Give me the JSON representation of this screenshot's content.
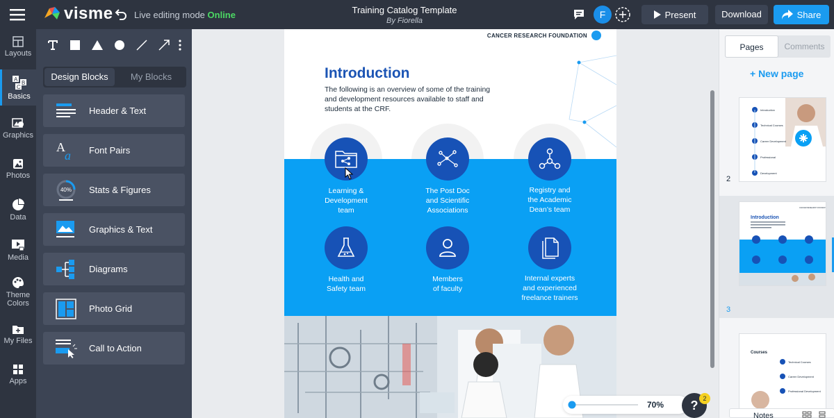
{
  "app": {
    "brand": "visme",
    "mode_label": "Live editing mode",
    "mode_status": "Online",
    "doc_title": "Training Catalog Template",
    "doc_author": "By Fiorella",
    "avatar_initial": "F",
    "present_label": "Present",
    "download_label": "Download",
    "share_label": "Share"
  },
  "leftnav": {
    "items": [
      {
        "label": "Layouts",
        "icon": "layouts-icon"
      },
      {
        "label": "Basics",
        "icon": "basics-icon"
      },
      {
        "label": "Graphics",
        "icon": "graphics-icon"
      },
      {
        "label": "Photos",
        "icon": "photos-icon"
      },
      {
        "label": "Data",
        "icon": "data-icon"
      },
      {
        "label": "Media",
        "icon": "media-icon"
      },
      {
        "label": "Theme Colors",
        "icon": "palette-icon"
      },
      {
        "label": "My Files",
        "icon": "folder-icon"
      },
      {
        "label": "Apps",
        "icon": "apps-icon"
      }
    ]
  },
  "panel": {
    "tabs": [
      "Design Blocks",
      "My Blocks"
    ],
    "blocks": [
      "Header & Text",
      "Font Pairs",
      "Stats & Figures",
      "Graphics & Text",
      "Diagrams",
      "Photo Grid",
      "Call to Action"
    ],
    "stats_icon_text": "40%"
  },
  "slide": {
    "org": "CANCER RESEARCH FOUNDATION",
    "title": "Introduction",
    "intro": "The following is an overview of some of the training and development resources available to staff and students at the CRF.",
    "items": [
      {
        "l1": "Learning &",
        "l2": "Development",
        "l3": "team",
        "icon": "folder-share-icon"
      },
      {
        "l1": "The Post Doc",
        "l2": "and Scientific",
        "l3": "Associations",
        "icon": "network-icon"
      },
      {
        "l1": "Registry and",
        "l2": "the Academic",
        "l3": "Dean’s team",
        "icon": "hierarchy-icon"
      },
      {
        "l1": "Health and",
        "l2": "Safety team",
        "l3": "",
        "icon": "flask-icon"
      },
      {
        "l1": "Members",
        "l2": "of faculty",
        "l3": "",
        "icon": "user-icon"
      },
      {
        "l1": "Internal experts",
        "l2": "and experienced",
        "l3": "freelance trainers",
        "icon": "documents-icon"
      }
    ]
  },
  "zoom": {
    "value": "70%"
  },
  "help": {
    "label": "?",
    "badge": "2"
  },
  "right": {
    "tabs": [
      "Pages",
      "Comments"
    ],
    "new_page": "+ New page",
    "pages": [
      {
        "num": "2",
        "items": [
          "Introduction",
          "Technical Courses",
          "Career Development",
          "Professional",
          "Development"
        ]
      },
      {
        "num": "3",
        "title": "Introduction"
      },
      {
        "num": "",
        "title": "Courses",
        "items": [
          "Technical Courses",
          "Career Development",
          "Professional Development"
        ]
      }
    ],
    "notes_label": "Notes"
  },
  "colors": {
    "brand_blue": "#1752b6",
    "accent": "#0aa0f4",
    "dark": "#2e3440",
    "online": "#4cd964"
  }
}
